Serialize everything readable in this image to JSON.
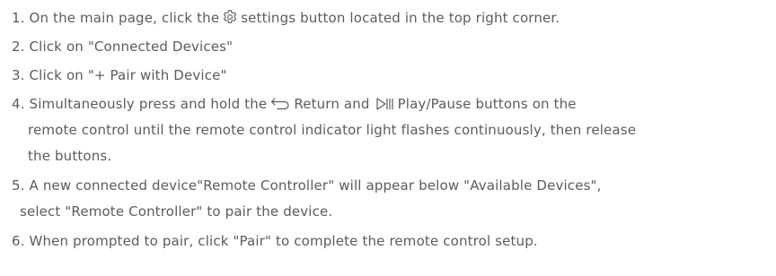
{
  "steps": [
    {
      "lines": [
        {
          "before": "1. On the main page, click the",
          "icon": "gear-icon",
          "after": "settings button located in the top right corner."
        }
      ]
    },
    {
      "lines": [
        {
          "text": "2. Click on \"Connected Devices\""
        }
      ]
    },
    {
      "lines": [
        {
          "text": "3. Click on \"+ Pair with Device\""
        }
      ]
    },
    {
      "lines": [
        {
          "before": "4. Simultaneously press and hold the",
          "icon1": "return-icon",
          "mid": "Return and",
          "icon2": "play-pause-icon",
          "after": "Play/Pause buttons on the"
        },
        {
          "text": "remote control until the remote control indicator light flashes continuously, then release"
        },
        {
          "text": "the buttons."
        }
      ]
    },
    {
      "lines": [
        {
          "text": "5. A new connected device\"Remote Controller\" will appear below \"Available Devices\","
        },
        {
          "text": "select \"Remote Controller\" to pair the device."
        }
      ]
    },
    {
      "lines": [
        {
          "text": "6. When prompted to pair, click \"Pair\" to complete the remote control setup."
        }
      ]
    }
  ]
}
